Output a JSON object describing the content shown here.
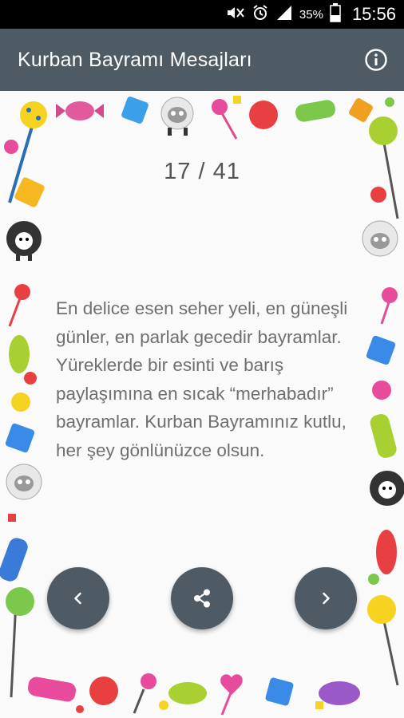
{
  "status_bar": {
    "battery_percent": "35%",
    "time": "15:56",
    "icons": [
      "mute-icon",
      "alarm-icon",
      "signal-icon",
      "battery-icon"
    ]
  },
  "app_bar": {
    "title": "Kurban Bayramı Mesajları",
    "info_icon": "info-icon"
  },
  "message_view": {
    "counter": "17 / 41",
    "text": "En delice esen seher yeli, en güneşli günler, en parlak gecedir bayramlar. Yüreklerde bir esinti ve barış paylaşımına en sıcak “merhabadır” bayramlar. Kurban Bayramınız kutlu, her şey gönlünüzce olsun."
  },
  "controls": {
    "prev_icon": "chevron-left-icon",
    "share_icon": "share-icon",
    "next_icon": "chevron-right-icon"
  },
  "colors": {
    "app_bar": "#4e5a64",
    "background": "#fafafa",
    "counter_text": "#555555",
    "message_text": "#6f6f6f"
  }
}
